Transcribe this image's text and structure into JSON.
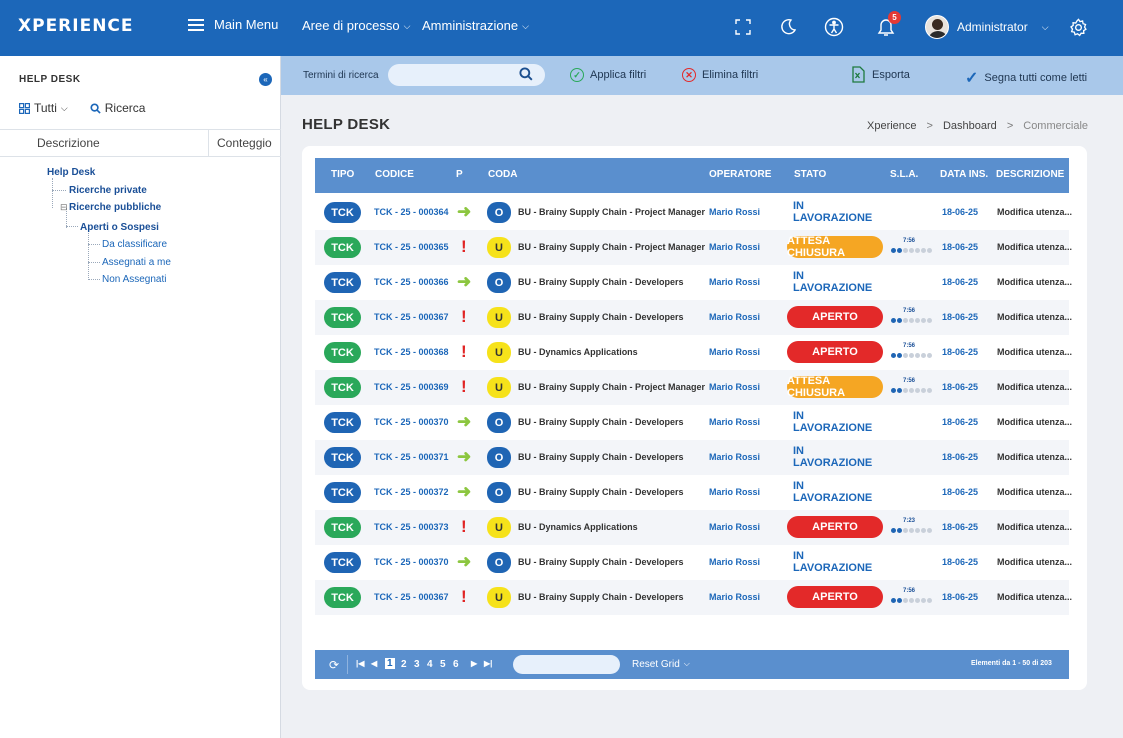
{
  "app": {
    "logo": "XPERIENCE",
    "main_menu": "Main Menu",
    "nav": [
      {
        "label": "Aree di processo"
      },
      {
        "label": "Amministrazione"
      }
    ],
    "notifications_count": "5",
    "user_name": "Administrator"
  },
  "sidebar": {
    "title": "HELP DESK",
    "tool_all": "Tutti",
    "tool_search": "Ricerca",
    "col_description": "Descrizione",
    "col_count": "Conteggio",
    "tree": {
      "help_desk": "Help Desk",
      "private": "Ricerche private",
      "public": "Ricerche pubbliche",
      "open": "Aperti o Sospesi",
      "to_classify": "Da classificare",
      "assigned_me": "Assegnati a me",
      "not_assigned": "Non Assegnati"
    }
  },
  "filterbar": {
    "search_label": "Termini di ricerca",
    "search_value": "",
    "apply": "Applica filtri",
    "clear": "Elimina filtri",
    "export": "Esporta",
    "mark_read": "Segna tutti come letti"
  },
  "page": {
    "title": "HELP DESK",
    "breadcrumb": [
      "Xperience",
      "Dashboard",
      "Commerciale"
    ]
  },
  "table": {
    "headers": {
      "tipo": "TIPO",
      "codice": "CODICE",
      "p": "P",
      "coda": "CODA",
      "operatore": "OPERATORE",
      "stato": "STATO",
      "sla": "S.L.A.",
      "data": "DATA INS.",
      "descrizione": "DESCRIZIONE"
    },
    "rows": [
      {
        "tipo": "TCK",
        "tipo_color": "blue",
        "codice": "TCK - 25 - 000364",
        "prio": "arrow",
        "coda_icon": "O",
        "coda": "BU - Brainy Supply Chain - Project Manager",
        "operatore": "Mario Rossi",
        "stato": "IN LAVORAZIONE",
        "stato_kind": "lav",
        "sla_time": "",
        "sla_level": 0,
        "data": "18-06-25",
        "descrizione": "Modifica utenza..."
      },
      {
        "tipo": "TCK",
        "tipo_color": "green",
        "codice": "TCK - 25 - 000365",
        "prio": "high",
        "coda_icon": "U",
        "coda": "BU - Brainy Supply Chain - Project Manager",
        "operatore": "Mario Rossi",
        "stato": "ATTESA CHIUSURA",
        "stato_kind": "att",
        "sla_time": "7:56",
        "sla_level": 2,
        "data": "18-06-25",
        "descrizione": "Modifica utenza..."
      },
      {
        "tipo": "TCK",
        "tipo_color": "blue",
        "codice": "TCK - 25 - 000366",
        "prio": "arrow",
        "coda_icon": "O",
        "coda": "BU - Brainy Supply Chain - Developers",
        "operatore": "Mario Rossi",
        "stato": "IN LAVORAZIONE",
        "stato_kind": "lav",
        "sla_time": "",
        "sla_level": 0,
        "data": "18-06-25",
        "descrizione": "Modifica utenza..."
      },
      {
        "tipo": "TCK",
        "tipo_color": "green",
        "codice": "TCK - 25 - 000367",
        "prio": "high",
        "coda_icon": "U",
        "coda": "BU - Brainy Supply Chain - Developers",
        "operatore": "Mario Rossi",
        "stato": "APERTO",
        "stato_kind": "ape",
        "sla_time": "7:56",
        "sla_level": 2,
        "data": "18-06-25",
        "descrizione": "Modifica utenza..."
      },
      {
        "tipo": "TCK",
        "tipo_color": "green",
        "codice": "TCK - 25 - 000368",
        "prio": "high",
        "coda_icon": "U",
        "coda": "BU - Dynamics Applications",
        "operatore": "Mario Rossi",
        "stato": "APERTO",
        "stato_kind": "ape",
        "sla_time": "7:56",
        "sla_level": 2,
        "data": "18-06-25",
        "descrizione": "Modifica utenza..."
      },
      {
        "tipo": "TCK",
        "tipo_color": "green",
        "codice": "TCK - 25 - 000369",
        "prio": "high",
        "coda_icon": "U",
        "coda": "BU - Brainy Supply Chain - Project Manager",
        "operatore": "Mario Rossi",
        "stato": "ATTESA CHIUSURA",
        "stato_kind": "att",
        "sla_time": "7:56",
        "sla_level": 2,
        "data": "18-06-25",
        "descrizione": "Modifica utenza..."
      },
      {
        "tipo": "TCK",
        "tipo_color": "blue",
        "codice": "TCK - 25 - 000370",
        "prio": "arrow",
        "coda_icon": "O",
        "coda": "BU - Brainy Supply Chain - Developers",
        "operatore": "Mario Rossi",
        "stato": "IN LAVORAZIONE",
        "stato_kind": "lav",
        "sla_time": "",
        "sla_level": 0,
        "data": "18-06-25",
        "descrizione": "Modifica utenza..."
      },
      {
        "tipo": "TCK",
        "tipo_color": "blue",
        "codice": "TCK - 25 - 000371",
        "prio": "arrow",
        "coda_icon": "O",
        "coda": "BU - Brainy Supply Chain - Developers",
        "operatore": "Mario Rossi",
        "stato": "IN LAVORAZIONE",
        "stato_kind": "lav",
        "sla_time": "",
        "sla_level": 0,
        "data": "18-06-25",
        "descrizione": "Modifica utenza..."
      },
      {
        "tipo": "TCK",
        "tipo_color": "blue",
        "codice": "TCK - 25 - 000372",
        "prio": "arrow",
        "coda_icon": "O",
        "coda": "BU - Brainy Supply Chain - Developers",
        "operatore": "Mario Rossi",
        "stato": "IN LAVORAZIONE",
        "stato_kind": "lav",
        "sla_time": "",
        "sla_level": 0,
        "data": "18-06-25",
        "descrizione": "Modifica utenza..."
      },
      {
        "tipo": "TCK",
        "tipo_color": "green",
        "codice": "TCK - 25 - 000373",
        "prio": "high",
        "coda_icon": "U",
        "coda": "BU - Dynamics Applications",
        "operatore": "Mario Rossi",
        "stato": "APERTO",
        "stato_kind": "ape",
        "sla_time": "7:23",
        "sla_level": 2,
        "data": "18-06-25",
        "descrizione": "Modifica utenza..."
      },
      {
        "tipo": "TCK",
        "tipo_color": "blue",
        "codice": "TCK - 25 - 000370",
        "prio": "arrow",
        "coda_icon": "O",
        "coda": "BU - Brainy Supply Chain - Developers",
        "operatore": "Mario Rossi",
        "stato": "IN LAVORAZIONE",
        "stato_kind": "lav",
        "sla_time": "",
        "sla_level": 0,
        "data": "18-06-25",
        "descrizione": "Modifica utenza..."
      },
      {
        "tipo": "TCK",
        "tipo_color": "green",
        "codice": "TCK - 25 - 000367",
        "prio": "high",
        "coda_icon": "U",
        "coda": "BU - Brainy Supply Chain - Developers",
        "operatore": "Mario Rossi",
        "stato": "APERTO",
        "stato_kind": "ape",
        "sla_time": "7:56",
        "sla_level": 2,
        "data": "18-06-25",
        "descrizione": "Modifica utenza..."
      }
    ]
  },
  "pager": {
    "pages": [
      "1",
      "2",
      "3",
      "4",
      "5",
      "6"
    ],
    "current": "1",
    "reset": "Reset Grid",
    "info": "Elementi da 1 - 50 di 203"
  },
  "colors": {
    "brand": "#1c67b9",
    "header": "#5a8fce",
    "filterbar": "#a9c8ea",
    "green": "#2aa85a",
    "red": "#e32929",
    "orange": "#f5a623",
    "yellow": "#f6e21a"
  },
  "icons": [
    "hamburger-icon",
    "fullscreen-icon",
    "moon-icon",
    "accessibility-icon",
    "bell-icon",
    "settings-icon",
    "search-icon",
    "check-icon",
    "close-icon",
    "excel-icon",
    "collapse-icon",
    "grid-icon",
    "refresh-icon"
  ]
}
